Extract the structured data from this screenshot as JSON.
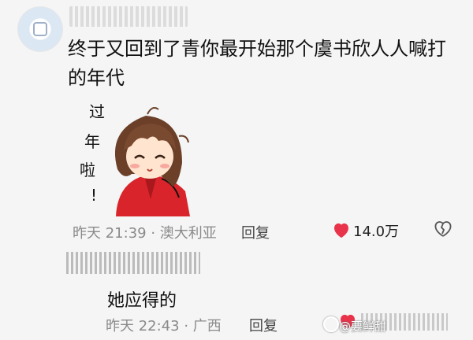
{
  "comment1": {
    "text": "终于又回到了青你最开始那个虞书欣人人喊打的年代",
    "sticker": {
      "caption_chars": [
        "过",
        "年",
        "啦",
        "!"
      ]
    },
    "meta": "昨天 21:39 · 澳大利亚",
    "reply_label": "回复",
    "like_count": "14.0万"
  },
  "comment2": {
    "text": "她应得的",
    "meta": "昨天 22:43 · 广西",
    "reply_label": "回复"
  },
  "watermark": "@要鲜甜",
  "colors": {
    "background": "#f5f5f5",
    "heart": "#e8334a",
    "meta_text": "#8a8a8a"
  }
}
